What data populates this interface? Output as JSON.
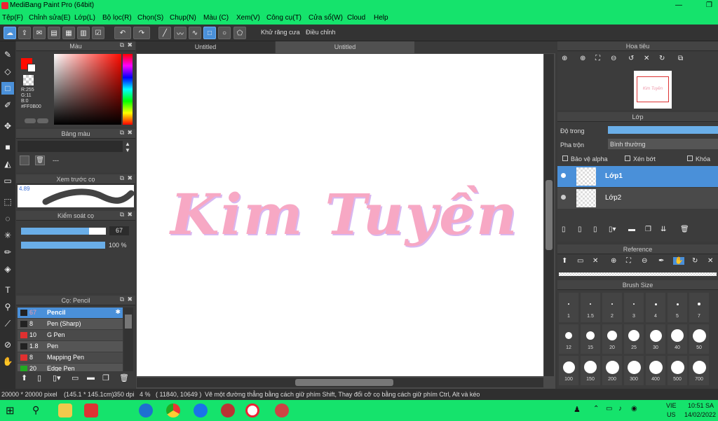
{
  "window": {
    "title": "MediBang Paint Pro (64bit)"
  },
  "menu": [
    "Tệp(F)",
    "Chỉnh sửa(E)",
    "Lớp(L)",
    "Bộ lọc(R)",
    "Chọn(S)",
    "Chụp(N)",
    "Màu (C)",
    "Xem(V)",
    "Công cụ(T)",
    "Cửa sổ(W)",
    "Cloud",
    "Help"
  ],
  "toolbar": {
    "antialias_label": "Khử răng cưa",
    "adjust_label": "Điều chỉnh"
  },
  "color_panel": {
    "title": "Màu",
    "r": "R:255",
    "g": "G:11",
    "b": "B:0",
    "hex": "#FF0B00",
    "fg": "#ff0b00"
  },
  "palette_panel": {
    "title": "Bảng màu",
    "value": "---"
  },
  "brush_preview": {
    "title": "Xem trước cọ",
    "size": "4.89"
  },
  "brush_control": {
    "title": "Kiểm soát cọ",
    "size": "67",
    "opacity": "100 %"
  },
  "brush_list": {
    "title": "Cọ: Pencil",
    "items": [
      {
        "size": "67",
        "name": "Pencil",
        "color": "#222"
      },
      {
        "size": "8",
        "name": "Pen (Sharp)",
        "color": "#222"
      },
      {
        "size": "10",
        "name": "G Pen",
        "color": "#e03030"
      },
      {
        "size": "1.8",
        "name": "Pen",
        "color": "#222"
      },
      {
        "size": "8",
        "name": "Mapping Pen",
        "color": "#e03030"
      },
      {
        "size": "20",
        "name": "Edge Pen",
        "color": "#2a2"
      }
    ]
  },
  "tabs": [
    "Untitled",
    "Untitled"
  ],
  "canvas_text": "Kim Tuyền",
  "navigator": {
    "title": "Hoa tiêu",
    "thumb_text": "Kim Tuyền"
  },
  "layer_panel": {
    "title": "Lớp",
    "opacity_label": "Độ trong",
    "blend_label": "Pha trộn",
    "blend_value": "Bình thường",
    "protect_alpha": "Bảo vệ alpha",
    "clipping": "Xén bớt",
    "lock": "Khóa",
    "layers": [
      {
        "name": "Lớp1"
      },
      {
        "name": "Lớp2"
      }
    ]
  },
  "reference": {
    "title": "Reference"
  },
  "brush_size": {
    "title": "Brush Size",
    "labels": [
      "1",
      "1.5",
      "2",
      "3",
      "4",
      "5",
      "7",
      "12",
      "15",
      "20",
      "25",
      "30",
      "40",
      "50",
      "100",
      "150",
      "200",
      "300",
      "400",
      "500",
      "700"
    ]
  },
  "status": {
    "size": "20000 * 20000 pixel",
    "cm": "(145.1 * 145.1cm)",
    "dpi": "350 dpi",
    "zoom": "4 %",
    "coords": "( 11840, 10649 )",
    "hint": "Vẽ một đường thẳng bằng cách giữ phím Shift, Thay đổi cỡ cọ bằng cách giữ phím Ctrl, Alt và kéo"
  },
  "taskbar": {
    "lang1": "VIE",
    "lang2": "US",
    "time": "10:51 SA",
    "date": "14/02/2022"
  }
}
